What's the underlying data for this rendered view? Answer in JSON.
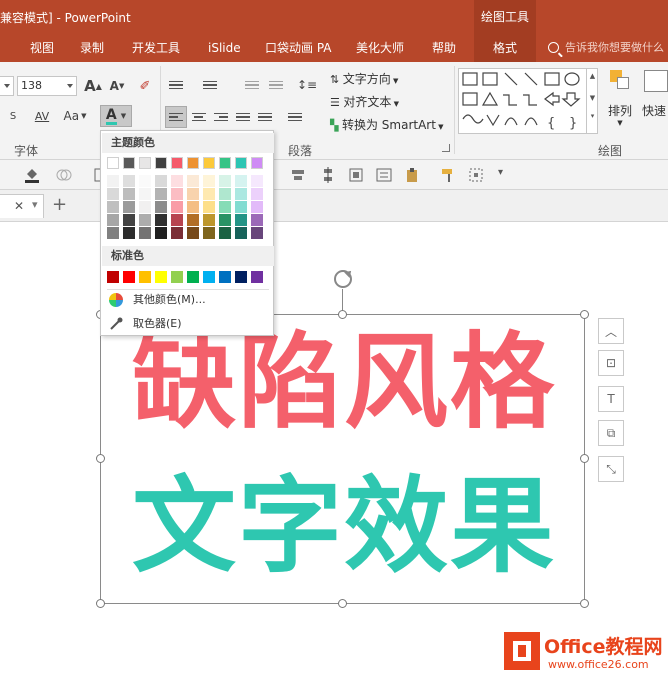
{
  "window": {
    "title": "兼容模式] - PowerPoint",
    "tools_title": "绘图工具"
  },
  "tabs": [
    {
      "label": "视图"
    },
    {
      "label": "录制"
    },
    {
      "label": "开发工具"
    },
    {
      "label": "iSlide"
    },
    {
      "label": "口袋动画 PA"
    },
    {
      "label": "美化大师"
    },
    {
      "label": "帮助"
    },
    {
      "label": "格式"
    }
  ],
  "tell_me": "告诉我你想要做什么",
  "ribbon": {
    "font_size": "138",
    "font_group_label": "字体",
    "paragraph_group_label": "段落",
    "drawing_group_label": "绘图",
    "text_direction": "文字方向",
    "align_text": "对齐文本",
    "convert_smartart": "转换为 SmartArt",
    "arrange_label": "排列",
    "quick_styles_label": "快速",
    "font_color_letter": "A",
    "increase_font_letter": "A",
    "decrease_font_letter": "A",
    "char_spacing_label": "AV",
    "change_case_label": "Aa"
  },
  "picker": {
    "theme_header": "主题颜色",
    "standard_header": "标准色",
    "more_colors": "其他颜色(M)...",
    "eyedropper": "取色器(E)",
    "theme_top_row": [
      "#ffffff",
      "#595959",
      "#e7e6e6",
      "#404040",
      "#f55a6a",
      "#ed9232",
      "#fcc93a",
      "#36c486",
      "#2ec5b3",
      "#cf8cf5"
    ],
    "standard_colors": [
      "#c00000",
      "#ff0000",
      "#ffc000",
      "#ffff00",
      "#92d050",
      "#00b050",
      "#00b0f0",
      "#0070c0",
      "#002060",
      "#7030a0"
    ]
  },
  "canvas": {
    "line1": "缺陷风格",
    "line2": "文字效果",
    "line1_color": "#f4606b",
    "line2_color": "#2ec7b0"
  },
  "watermark": {
    "title": "Office教程网",
    "url": "www.office26.com"
  }
}
